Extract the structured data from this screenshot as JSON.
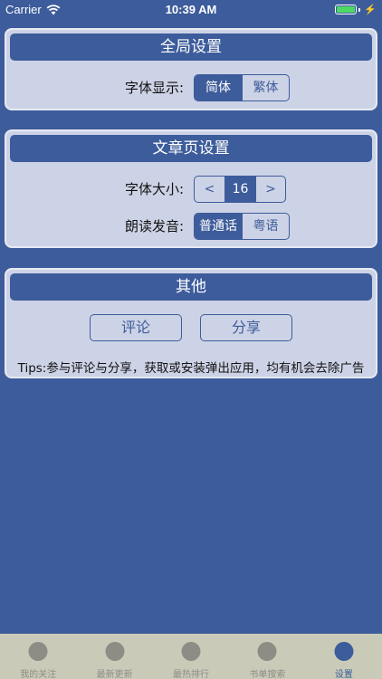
{
  "status_bar": {
    "carrier": "Carrier",
    "time": "10:39 AM"
  },
  "global_settings": {
    "title": "全局设置",
    "font_display_label": "字体显示:",
    "font_options": [
      "简体",
      "繁体"
    ],
    "font_selected": "简体"
  },
  "article_settings": {
    "title": "文章页设置",
    "font_size_label": "字体大小:",
    "decrease": "<",
    "font_size": "16",
    "increase": ">",
    "voice_label": "朗读发音:",
    "voice_options": [
      "普通话",
      "粤语"
    ],
    "voice_selected": "普通话"
  },
  "other": {
    "title": "其他",
    "comment_button": "评论",
    "share_button": "分享",
    "tips": "Tips:参与评论与分享，获取或安装弹出应用，均有机会去除广告"
  },
  "tab_bar": {
    "items": [
      {
        "label": "我的关注",
        "active": false
      },
      {
        "label": "最新更新",
        "active": false
      },
      {
        "label": "最热排行",
        "active": false
      },
      {
        "label": "书单搜索",
        "active": false
      },
      {
        "label": "设置",
        "active": true
      }
    ]
  },
  "colors": {
    "background": "#3d5c9b",
    "card": "#cdd3e6",
    "tab_bar": "#c9cbb8",
    "battery": "#4cd964"
  }
}
